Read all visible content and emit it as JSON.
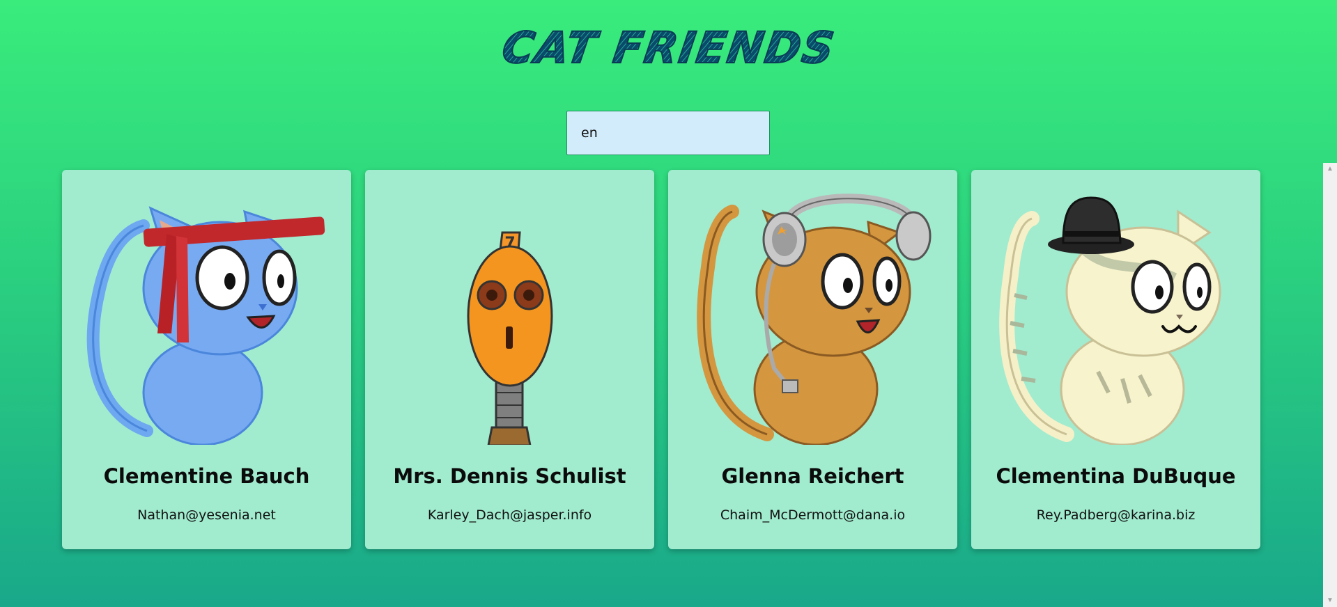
{
  "header": {
    "title": "CAT FRIENDS"
  },
  "search": {
    "value": "en"
  },
  "cards": [
    {
      "name": "Clementine Bauch",
      "email": "Nathan@yesenia.net",
      "icon": "blue-cat-headband"
    },
    {
      "name": "Mrs. Dennis Schulist",
      "email": "Karley_Dach@jasper.info",
      "icon": "orange-robot-head"
    },
    {
      "name": "Glenna Reichert",
      "email": "Chaim_McDermott@dana.io",
      "icon": "orange-cat-headphones"
    },
    {
      "name": "Clementina DuBuque",
      "email": "Rey.Padberg@karina.biz",
      "icon": "cream-cat-top-hat"
    }
  ],
  "colors": {
    "background_top": "#39ec7c",
    "background_bottom": "#19a88a",
    "card": "#a1ebcf",
    "title": "#0a4a6a",
    "search_bg": "#d3ecfb"
  }
}
